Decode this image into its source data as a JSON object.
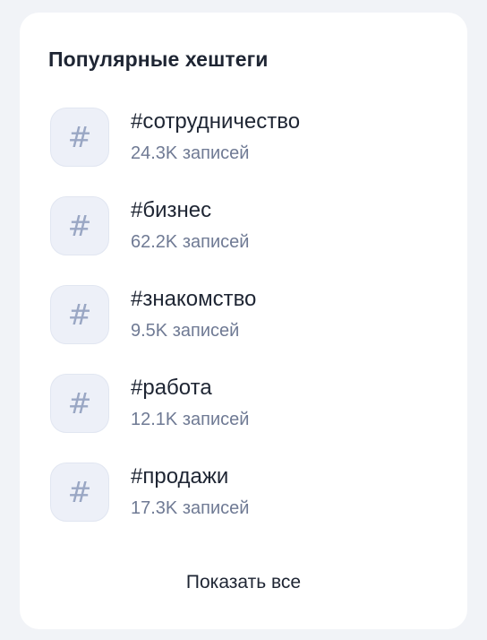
{
  "widget": {
    "title": "Популярные хештеги",
    "show_all_label": "Показать все",
    "hash_symbol": "#",
    "items": [
      {
        "tag": "#сотрудничество",
        "count": "24.3K записей"
      },
      {
        "tag": "#бизнес",
        "count": "62.2K записей"
      },
      {
        "tag": "#знакомство",
        "count": "9.5K записей"
      },
      {
        "tag": "#работа",
        "count": "12.1K записей"
      },
      {
        "tag": "#продажи",
        "count": "17.3K записей"
      }
    ]
  }
}
